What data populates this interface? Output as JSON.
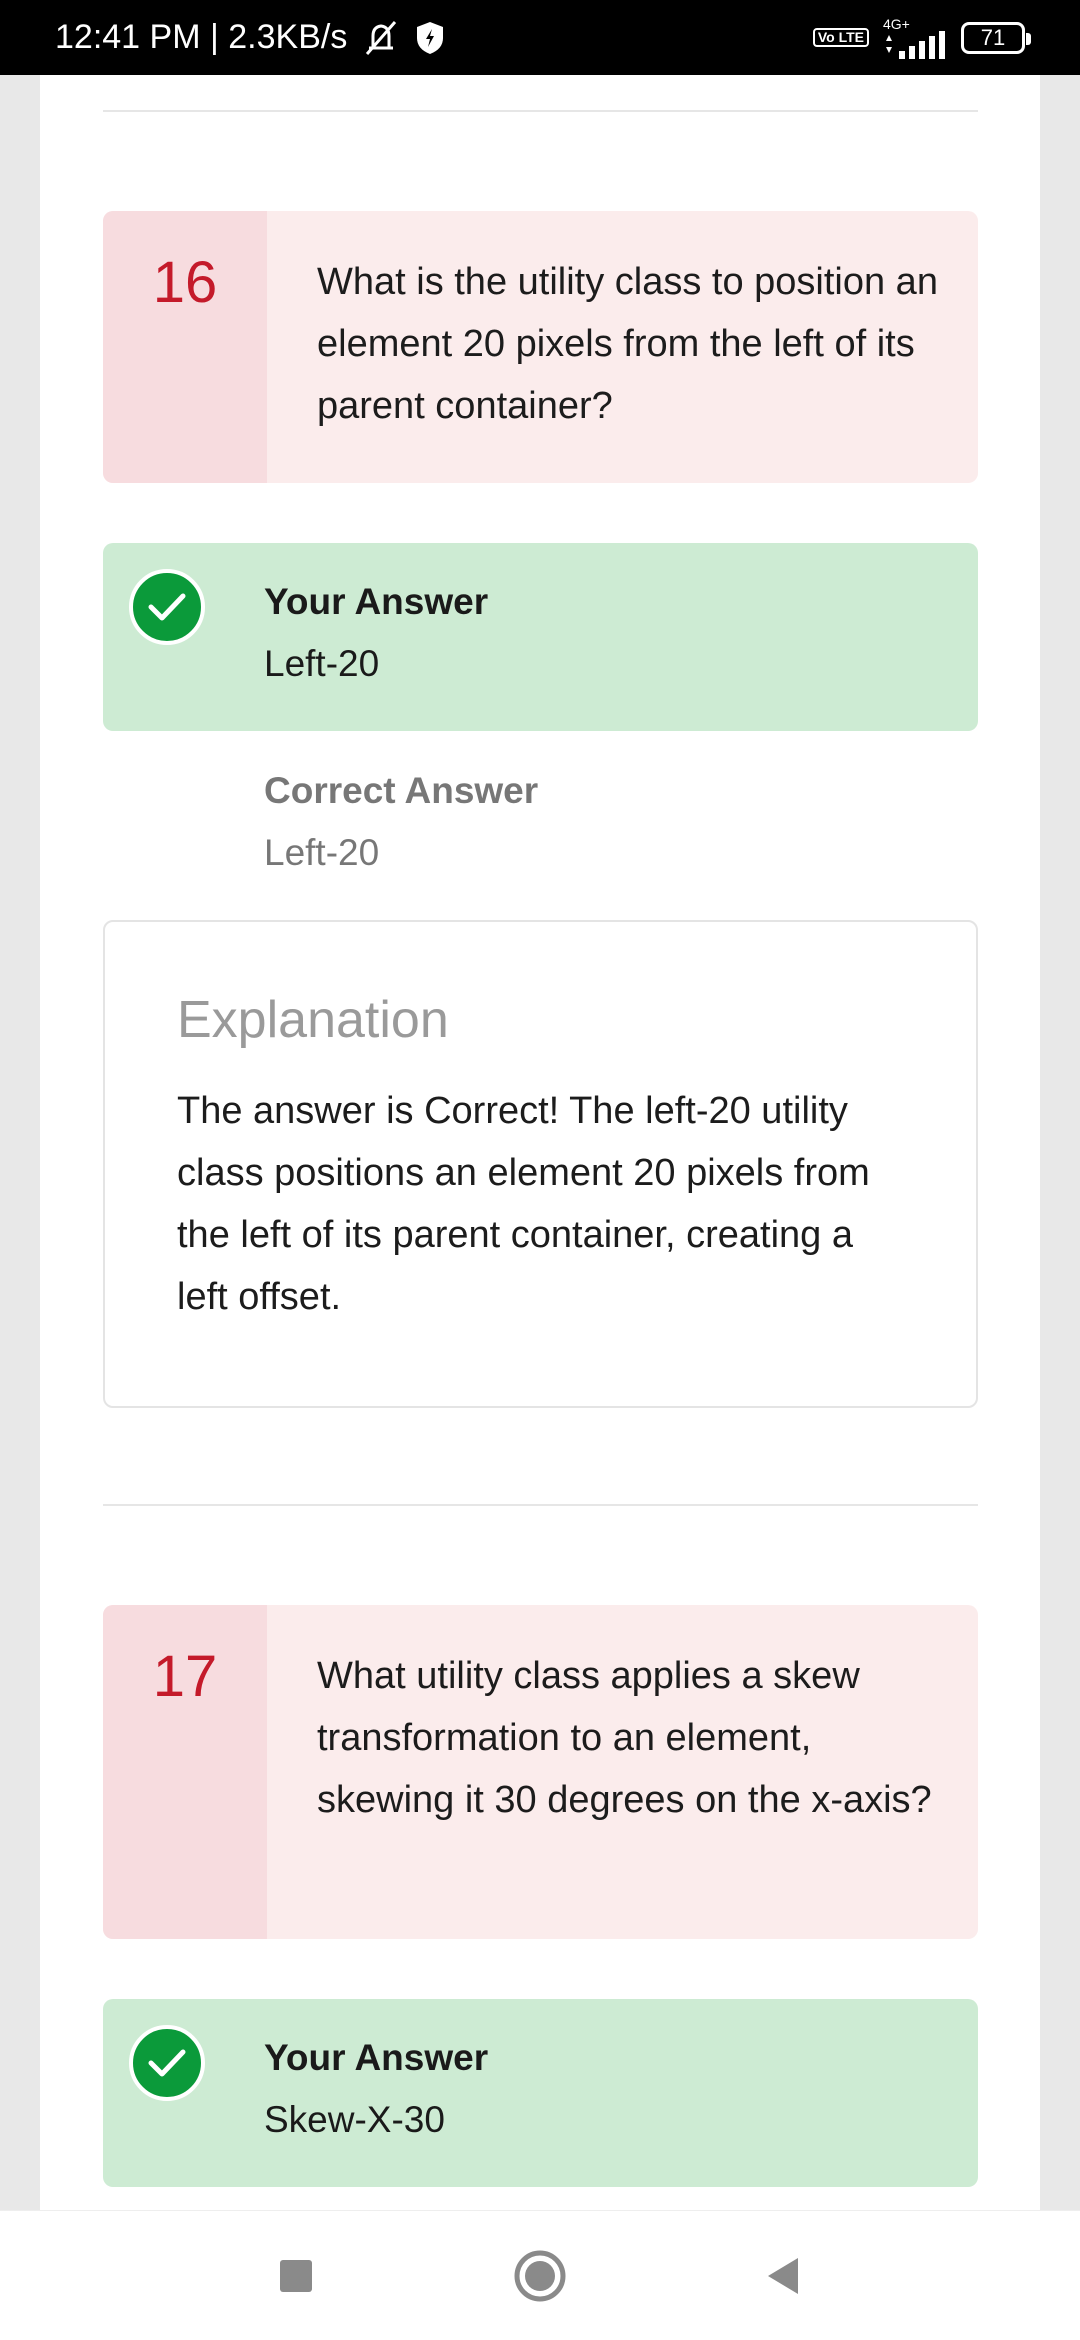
{
  "status_bar": {
    "time_speed": "12:41 PM | 2.3KB/s",
    "volte": "Vo LTE",
    "network": "4G+",
    "battery": "71"
  },
  "items": [
    {
      "number": "16",
      "question": "What is the utility class to position an element 20 pixels from the left of its parent container?",
      "your_answer_label": "Your Answer",
      "your_answer": "Left-20",
      "correct_answer_label": "Correct Answer",
      "correct_answer": "Left-20",
      "explanation_title": "Explanation",
      "explanation": "The answer is Correct! The left-20 utility class positions an element 20 pixels from the left of its parent container, creating a left offset."
    },
    {
      "number": "17",
      "question": "What utility class applies a skew transformation to an element, skewing it 30 degrees on the x-axis?",
      "your_answer_label": "Your Answer",
      "your_answer": "Skew-X-30"
    }
  ],
  "colors": {
    "question_bg": "#fbecec",
    "question_num_bg": "#f7dcdf",
    "question_num": "#c41a2a",
    "answer_bg": "#cdebd3",
    "check": "#0b9a3a"
  },
  "nav": {
    "recent_icon": "square-icon",
    "home_icon": "circle-icon",
    "back_icon": "triangle-back-icon"
  }
}
